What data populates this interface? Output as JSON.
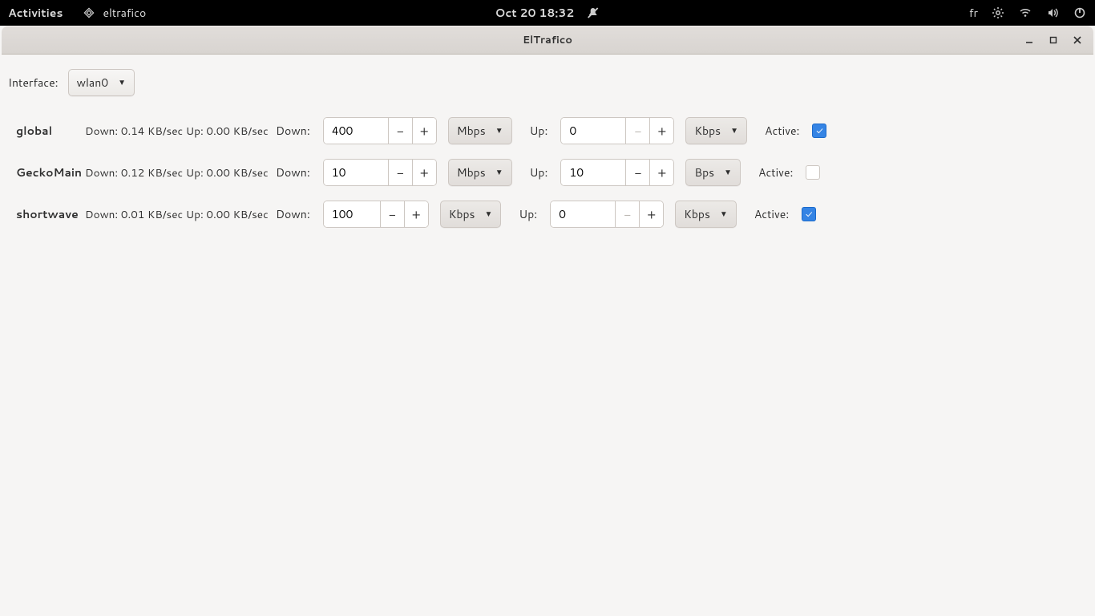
{
  "topbar": {
    "activities": "Activities",
    "app_name": "eltrafico",
    "datetime": "Oct 20  18:32",
    "keyboard_layout": "fr"
  },
  "window": {
    "title": "ElTrafico"
  },
  "interface": {
    "label": "Interface:",
    "selected": "wlan0"
  },
  "rows": [
    {
      "name": "global",
      "stats": "Down: 0.14 KB/sec Up: 0.00 KB/sec",
      "down_label": "Down:",
      "down_value": "400",
      "down_unit": "Mbps",
      "up_label": "Up:",
      "up_value": "0",
      "up_unit": "Kbps",
      "active_label": "Active:",
      "active_checked": true,
      "up_minus_disabled": true
    },
    {
      "name": "GeckoMain",
      "stats": "Down: 0.12 KB/sec Up: 0.00 KB/sec",
      "down_label": "Down:",
      "down_value": "10",
      "down_unit": "Mbps",
      "up_label": "Up:",
      "up_value": "10",
      "up_unit": "Bps",
      "active_label": "Active:",
      "active_checked": false,
      "up_minus_disabled": false
    },
    {
      "name": "shortwave",
      "stats": "Down: 0.01 KB/sec Up: 0.00 KB/sec",
      "down_label": "Down:",
      "down_value": "100",
      "down_unit": "Kbps",
      "up_label": "Up:",
      "up_value": "0",
      "up_unit": "Kbps",
      "active_label": "Active:",
      "active_checked": true,
      "up_minus_disabled": true
    }
  ]
}
